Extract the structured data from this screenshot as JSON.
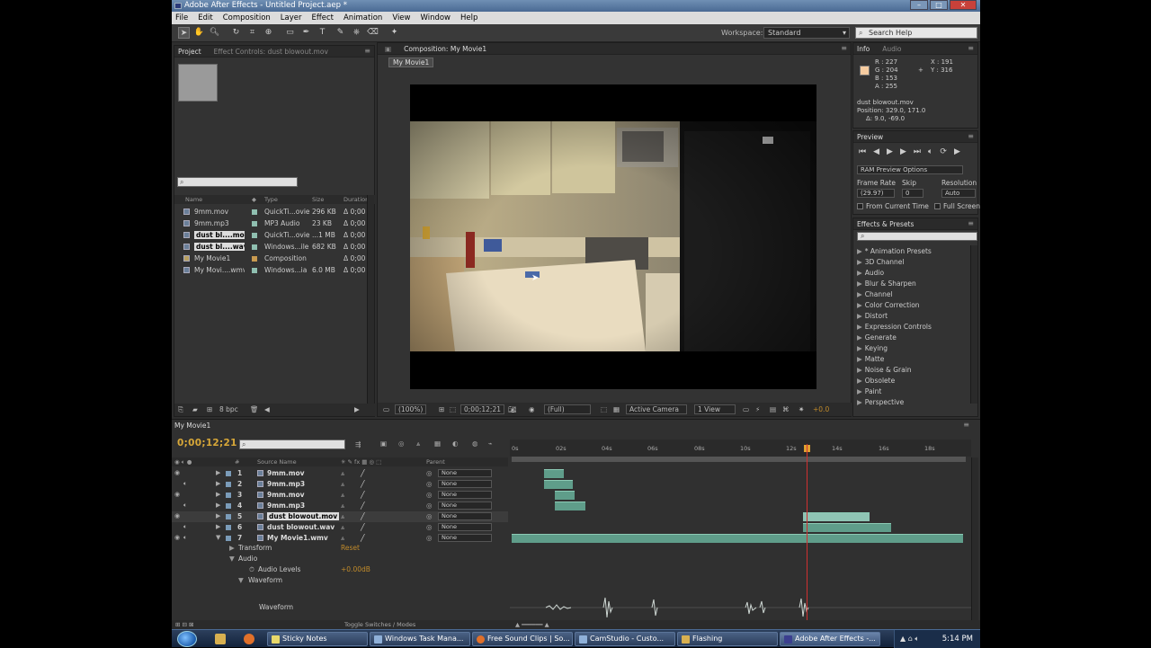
{
  "window": {
    "title": "Adobe After Effects - Untitled Project.aep *"
  },
  "menu": [
    "File",
    "Edit",
    "Composition",
    "Layer",
    "Effect",
    "Animation",
    "View",
    "Window",
    "Help"
  ],
  "toolbar": {
    "workspace_label": "Workspace:",
    "workspace_value": "Standard",
    "search_placeholder": "Search Help"
  },
  "project_panel": {
    "tabs": [
      "Project",
      "Effect Controls: dust blowout.mov"
    ],
    "columns": [
      "Name",
      "Type",
      "Size",
      "Duration"
    ],
    "items": [
      {
        "name": "9mm.mov",
        "type": "QuickTi...ovie",
        "size": "296 KB",
        "duration": "Δ 0;00"
      },
      {
        "name": "9mm.mp3",
        "type": "MP3 Audio",
        "size": "23 KB",
        "duration": "Δ 0;00"
      },
      {
        "name": "dust bl....mov",
        "type": "QuickTi...ovie",
        "size": "...1 MB",
        "duration": "Δ 0;00"
      },
      {
        "name": "dust bl....wav",
        "type": "Windows...ile",
        "size": "682 KB",
        "duration": "Δ 0;00"
      },
      {
        "name": "My Movie1",
        "type": "Composition",
        "size": "",
        "duration": "Δ 0;00"
      },
      {
        "name": "My Movi....wmv",
        "type": "Windows...ia",
        "size": "6.0 MB",
        "duration": "Δ 0;00"
      }
    ],
    "bpc": "8 bpc"
  },
  "composition_panel": {
    "tab": "Composition: My Movie1",
    "subtab": "My Movie1",
    "footer": {
      "zoom": "(100%)",
      "timecode": "0;00;12;21",
      "resolution": "(Full)",
      "camera": "Active Camera",
      "views": "1 View",
      "exposure": "+0.0"
    }
  },
  "info_panel": {
    "tabs": [
      "Info",
      "Audio"
    ],
    "rgba": [
      "R : 227",
      "G : 204",
      "B : 153",
      "A : 255"
    ],
    "coords": [
      "X : 191",
      "Y : 316"
    ],
    "details": [
      "dust blowout.mov",
      "Position: 329.0, 171.0",
      "Δ: 9.0, -69.0"
    ]
  },
  "preview_panel": {
    "tab": "Preview",
    "options": "RAM Preview Options",
    "labels": [
      "Frame Rate",
      "Skip",
      "Resolution"
    ],
    "frame_rate": "(29.97)",
    "skip": "0",
    "resolution": "Auto",
    "from_current": "From Current Time",
    "full_screen": "Full Screen"
  },
  "effects_panel": {
    "tab": "Effects & Presets",
    "items": [
      "* Animation Presets",
      "3D Channel",
      "Audio",
      "Blur & Sharpen",
      "Channel",
      "Color Correction",
      "Distort",
      "Expression Controls",
      "Generate",
      "Keying",
      "Matte",
      "Noise & Grain",
      "Obsolete",
      "Paint",
      "Perspective"
    ]
  },
  "timeline": {
    "tab": "My Movie1",
    "timecode": "0;00;12;21",
    "columns": [
      "Source Name",
      "Parent"
    ],
    "layers": [
      {
        "num": "1",
        "name": "9mm.mov",
        "parent": "None"
      },
      {
        "num": "2",
        "name": "9mm.mp3",
        "parent": "None"
      },
      {
        "num": "3",
        "name": "9mm.mov",
        "parent": "None"
      },
      {
        "num": "4",
        "name": "9mm.mp3",
        "parent": "None"
      },
      {
        "num": "5",
        "name": "dust blowout.mov",
        "parent": "None"
      },
      {
        "num": "6",
        "name": "dust blowout.wav",
        "parent": "None"
      },
      {
        "num": "7",
        "name": "My Movie1.wmv",
        "parent": "None"
      }
    ],
    "props": {
      "transform": "Transform",
      "reset": "Reset",
      "audio": "Audio",
      "levels": "Audio Levels",
      "levels_value": "+0.00dB",
      "waveform": "Waveform",
      "waveform2": "Waveform"
    },
    "ruler": [
      "0s",
      "02s",
      "04s",
      "06s",
      "08s",
      "10s",
      "12s",
      "14s",
      "16s",
      "18s"
    ],
    "footer": "Toggle Switches / Modes"
  },
  "taskbar": {
    "tasks": [
      "Sticky Notes",
      "Windows Task Mana...",
      "Free Sound Clips | So...",
      "CamStudio - Custo...",
      "Flashing",
      "Adobe After Effects -..."
    ],
    "clock": "5:14 PM"
  },
  "colors": {
    "accent": "#d8a838",
    "track": "#5f9d8a",
    "cti": "#d03030"
  }
}
